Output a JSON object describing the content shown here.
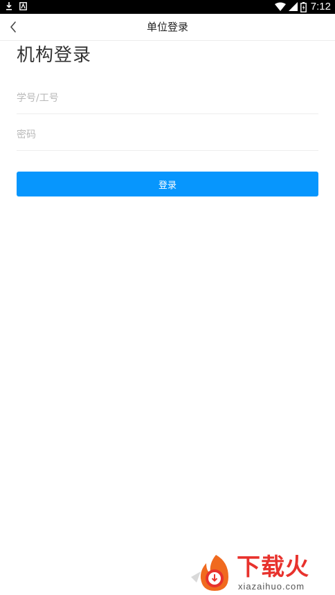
{
  "status_bar": {
    "time": "7:12",
    "icons": [
      "download-icon",
      "app-icon",
      "wifi-icon",
      "signal-icon",
      "battery-icon"
    ]
  },
  "header": {
    "title": "单位登录",
    "back_icon": "chevron-left-icon"
  },
  "main": {
    "title": "机构登录",
    "account_field": {
      "placeholder": "学号/工号",
      "value": ""
    },
    "password_field": {
      "placeholder": "密码",
      "value": ""
    },
    "login_label": "登录"
  },
  "watermark": {
    "brand": "下载火",
    "url": "xiazaihuo.com"
  },
  "colors": {
    "accent": "#0796fd",
    "status_bar": "#000000",
    "watermark_red": "#e8322d"
  }
}
